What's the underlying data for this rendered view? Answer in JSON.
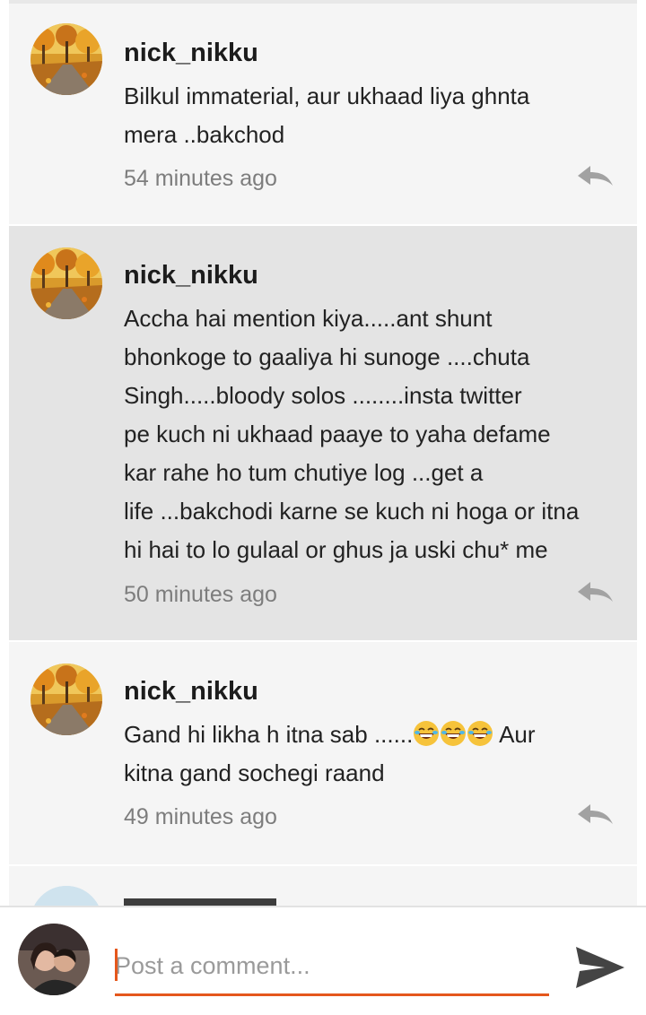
{
  "comments": [
    {
      "author": "nick_nikku",
      "text_lines": [
        "Bilkul immaterial, aur ukhaad liya ghnta",
        "mera ..bakchod"
      ],
      "time": "54 minutes ago",
      "avatar_icon": "autumn-trees-avatar",
      "reply_icon": "reply-icon"
    },
    {
      "author": "nick_nikku",
      "text_lines": [
        "Accha hai mention kiya.....ant shunt",
        "bhonkoge to gaaliya hi sunoge ....chuta",
        "Singh.....bloody solos ........insta twitter",
        "pe kuch ni ukhaad paaye to yaha defame",
        "kar rahe ho tum chutiye log ...get a",
        "life ...bakchodi karne se kuch ni hoga or itna",
        "hi hai to lo gulaal or ghus ja uski chu* me"
      ],
      "time": "50 minutes ago",
      "avatar_icon": "autumn-trees-avatar",
      "reply_icon": "reply-icon"
    },
    {
      "author": "nick_nikku",
      "text_line_1": "Gand hi likha h itna sab ......",
      "emoji": "laughing-face-emoji",
      "text_line_1_end": " Aur",
      "text_line_2": "kitna gand sochegi raand",
      "time": "49 minutes ago",
      "avatar_icon": "autumn-trees-avatar",
      "reply_icon": "reply-icon"
    }
  ],
  "comment_box": {
    "placeholder": "Post a comment...",
    "value": "",
    "send_icon": "send-icon",
    "avatar_icon": "user-photo-avatar"
  },
  "colors": {
    "accent": "#e5571c",
    "card": "#f5f5f5",
    "card_highlight": "#e4e4e4",
    "muted_text": "#7d7d7d"
  }
}
